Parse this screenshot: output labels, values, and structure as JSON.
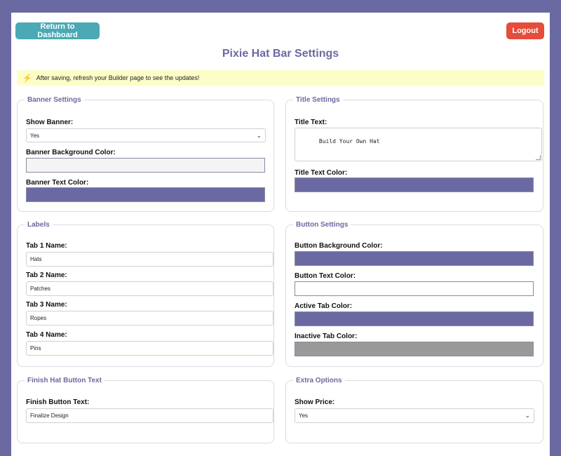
{
  "header": {
    "dashboard_label": "Return to Dashboard",
    "logout_label": "Logout",
    "title": "Pixie Hat Bar Settings"
  },
  "notice": {
    "icon": "lightning-icon",
    "text": "After saving, refresh your Builder page to see the updates!"
  },
  "colors": {
    "page_bg": "#6b69a2",
    "accent": "#6b69a2",
    "dashboard_button": "#4aa9b4",
    "logout_button": "#e54c3c",
    "notice_bg": "#fdfdc8"
  },
  "banner": {
    "legend": "Banner Settings",
    "show_label": "Show Banner:",
    "show_value": "Yes",
    "bg_label": "Banner Background Color:",
    "bg_color": "#f4f4f4",
    "text_label": "Banner Text Color:",
    "text_color": "#6b69a2"
  },
  "title_settings": {
    "legend": "Title Settings",
    "text_label": "Title Text:",
    "text_value": "Build Your Own Hat",
    "color_label": "Title Text Color:",
    "color": "#6b69a2"
  },
  "labels": {
    "legend": "Labels",
    "tab1_label": "Tab 1 Name:",
    "tab1_value": "Hats",
    "tab2_label": "Tab 2 Name:",
    "tab2_value": "Patches",
    "tab3_label": "Tab 3 Name:",
    "tab3_value": "Ropes",
    "tab4_label": "Tab 4 Name:",
    "tab4_value": "Pins"
  },
  "button_settings": {
    "legend": "Button Settings",
    "bg_label": "Button Background Color:",
    "bg_color": "#6b69a2",
    "text_label": "Button Text Color:",
    "text_color": "#ffffff",
    "active_label": "Active Tab Color:",
    "active_color": "#6b69a2",
    "inactive_label": "Inactive Tab Color:",
    "inactive_color": "#999999"
  },
  "finish": {
    "legend": "Finish Hat Button Text",
    "label": "Finish Button Text:",
    "value": "Finalize Design"
  },
  "extra": {
    "legend": "Extra Options",
    "price_label": "Show Price:",
    "price_value": "Yes"
  }
}
